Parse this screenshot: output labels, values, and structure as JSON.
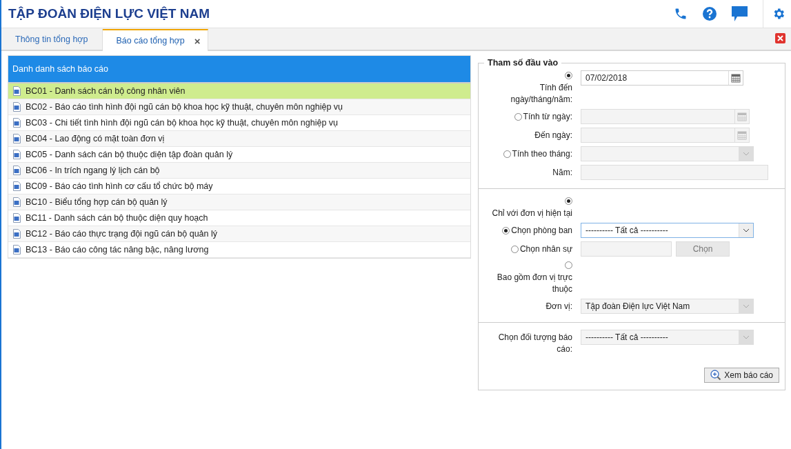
{
  "header": {
    "title": "TẬP ĐOÀN ĐIỆN LỰC VIỆT NAM"
  },
  "tabs": [
    {
      "label": "Thông tin tổng hợp",
      "selected": false
    },
    {
      "label": "Báo cáo tổng hợp",
      "selected": true,
      "close": "×"
    }
  ],
  "report_list": {
    "title": "Danh danh sách báo cáo",
    "items": [
      {
        "label": "BC01 - Danh sách cán bộ công nhân viên",
        "selected": true
      },
      {
        "label": "BC02 - Báo cáo tình hình đội ngũ cán bộ khoa học kỹ thuật, chuyên môn nghiệp vụ",
        "selected": false
      },
      {
        "label": "BC03 - Chi tiết tình hình đội ngũ cán bộ khoa học kỹ thuật, chuyên môn nghiệp vụ",
        "selected": false
      },
      {
        "label": "BC04 - Lao động có mặt toàn đơn vị",
        "selected": false
      },
      {
        "label": "BC05 - Danh sách cán bộ thuộc diện tập đoàn quản lý",
        "selected": false
      },
      {
        "label": "BC06 - In trích ngang lý lịch cán bộ",
        "selected": false
      },
      {
        "label": "BC09 - Báo cáo tình hình cơ cấu tổ chức bộ máy",
        "selected": false
      },
      {
        "label": "BC10 - Biểu tổng hợp cán bộ quản lý",
        "selected": false
      },
      {
        "label": "BC11 - Danh sách cán bộ thuộc diện quy hoạch",
        "selected": false
      },
      {
        "label": "BC12 - Báo cáo thực trạng đội ngũ cán bộ quản lý",
        "selected": false
      },
      {
        "label": "BC13 - Báo cáo công tác nâng bậc, nâng lương",
        "selected": false
      }
    ]
  },
  "parameters": {
    "title": "Tham số đầu vào",
    "sections": [
      {
        "rows": [
          {
            "kind": "radio-stacked",
            "label": "Tính đến ngày/tháng/năm:",
            "selected": true,
            "controls": [
              {
                "kind": "date",
                "value": "07/02/2018",
                "disabled": false
              }
            ]
          },
          {
            "kind": "radio-inline",
            "label": "Tính từ ngày:",
            "selected": false,
            "controls": [
              {
                "kind": "date",
                "disabled": true
              }
            ]
          },
          {
            "kind": "label",
            "label": "Đến ngày:",
            "controls": [
              {
                "kind": "date",
                "disabled": true
              }
            ]
          },
          {
            "kind": "radio-inline",
            "label": "Tính theo tháng:",
            "selected": false,
            "controls": [
              {
                "kind": "select",
                "disabled": true
              }
            ]
          },
          {
            "kind": "label",
            "label": "Năm:",
            "controls": [
              {
                "kind": "text",
                "disabled": true
              }
            ]
          }
        ]
      },
      {
        "rows": [
          {
            "kind": "radio-stacked",
            "label": "Chỉ với đơn vị hiện tại",
            "selected": true,
            "controls": []
          },
          {
            "kind": "radio-inline",
            "label": "Chọn phòng ban",
            "selected": true,
            "controls": [
              {
                "kind": "select",
                "value": "---------- Tất cả ----------",
                "disabled": false
              }
            ]
          },
          {
            "kind": "radio-inline",
            "label": "Chọn nhân sự",
            "selected": false,
            "controls": [
              {
                "kind": "text",
                "disabled": true
              },
              {
                "kind": "button",
                "value": "Chọn",
                "disabled": true
              }
            ]
          },
          {
            "kind": "radio-stacked",
            "label": "Bao gồm đơn vị trực thuộc",
            "selected": false,
            "controls": []
          },
          {
            "kind": "label",
            "label": "Đơn vị:",
            "controls": [
              {
                "kind": "select",
                "value": "Tập đoàn Điện lực Việt Nam",
                "disabled": true
              }
            ]
          }
        ]
      },
      {
        "rows": [
          {
            "kind": "label",
            "label": "Chọn đối tượng báo cáo:",
            "controls": [
              {
                "kind": "select",
                "value": "---------- Tất cả ----------",
                "disabled": true
              }
            ]
          }
        ]
      }
    ],
    "submit": "Xem báo cáo"
  }
}
